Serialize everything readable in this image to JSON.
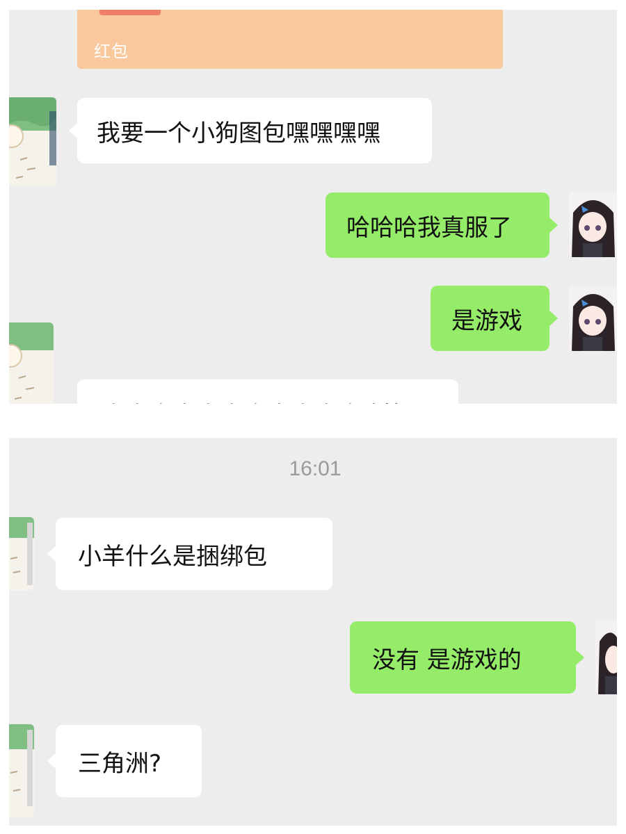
{
  "screenshot_top": {
    "red_packet": {
      "label": "红包"
    },
    "messages": [
      {
        "side": "in",
        "text": "我要一个小狗图包嘿嘿嘿嘿"
      },
      {
        "side": "out",
        "text": "哈哈哈我真服了"
      },
      {
        "side": "out",
        "text": "是游戏"
      },
      {
        "side": "in",
        "text": "哈哈哈哈哈哈哈哈哈哈哈哈笑死"
      }
    ]
  },
  "screenshot_bottom": {
    "timestamp": "16:01",
    "messages": [
      {
        "side": "in",
        "text": "小羊什么是捆绑包"
      },
      {
        "side": "out",
        "text": "没有 是游戏的"
      },
      {
        "side": "in",
        "text": "三角洲?"
      }
    ]
  },
  "avatars": {
    "contact": "cartoon-dog-avatar",
    "self": "anime-girl-avatar"
  },
  "colors": {
    "chat_background": "#ededed",
    "incoming_bubble": "#ffffff",
    "outgoing_bubble": "#95ec69",
    "red_packet": "#f9c89c",
    "timestamp_text": "#9a9a9a"
  }
}
